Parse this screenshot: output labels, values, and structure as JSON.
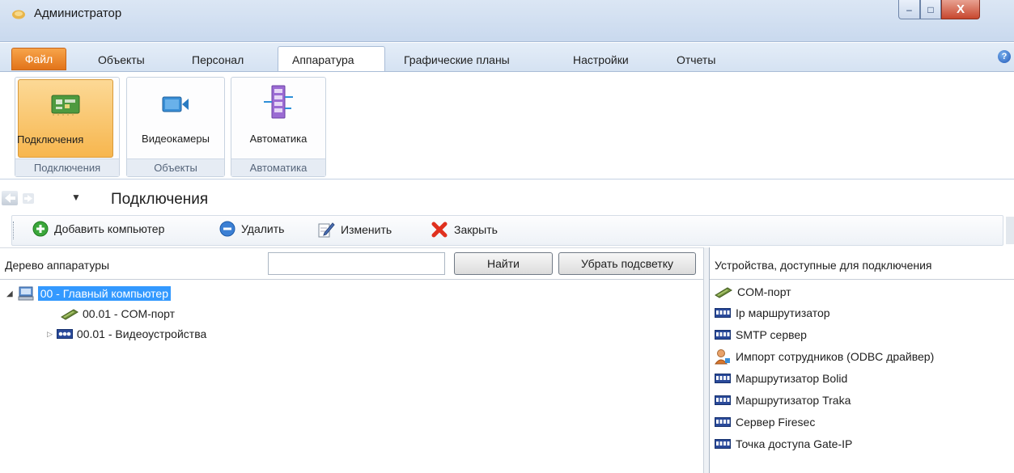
{
  "window": {
    "title": "Администратор",
    "buttons": {
      "minimize": "–",
      "maximize": "□",
      "close": "X"
    }
  },
  "tabs": {
    "file": "Файл",
    "items": [
      "Объекты",
      "Персонал",
      "Аппаратура",
      "Графические планы",
      "Настройки",
      "Отчеты"
    ],
    "active": "Аппаратура",
    "help": "?"
  },
  "ribbon": {
    "groups": [
      {
        "label": "Подключения",
        "button": "Подключения",
        "icon": "circuit-board-icon"
      },
      {
        "label": "Объекты",
        "button": "Видеокамеры",
        "icon": "video-camera-icon"
      },
      {
        "label": "Автоматика",
        "button": "Автоматика",
        "icon": "automation-icon"
      }
    ]
  },
  "nav": {
    "title": "Подключения"
  },
  "toolbar": {
    "add": "Добавить компьютер",
    "delete": "Удалить",
    "edit": "Изменить",
    "close": "Закрыть"
  },
  "tree_pane": {
    "label": "Дерево аппаратуры",
    "search_value": "",
    "find": "Найти",
    "clear_highlight": "Убрать подсветку",
    "nodes": [
      {
        "text": "00 - Главный компьютер",
        "icon": "computer-icon",
        "selected": true
      },
      {
        "text": "00.01 - COM-порт",
        "icon": "com-port-icon"
      },
      {
        "text": "00.01 - Видеоустройства",
        "icon": "video-devices-icon"
      }
    ]
  },
  "devices_pane": {
    "label": "Устройства, доступные для подключения",
    "items": [
      {
        "text": "COM-порт",
        "icon": "com-port-icon"
      },
      {
        "text": "Ip маршрутизатор",
        "icon": "router-icon"
      },
      {
        "text": "SMTP сервер",
        "icon": "router-icon"
      },
      {
        "text": "Импорт сотрудников (ODBC драйвер)",
        "icon": "person-import-icon"
      },
      {
        "text": "Маршрутизатор Bolid",
        "icon": "router-icon"
      },
      {
        "text": "Маршрутизатор Traka",
        "icon": "router-icon"
      },
      {
        "text": "Сервер Firesec",
        "icon": "router-icon"
      },
      {
        "text": "Точка доступа Gate-IP",
        "icon": "router-icon"
      }
    ]
  },
  "colors": {
    "file_tab": "#e2741a",
    "selection": "#3399ff",
    "ribbon_active": "#f7b64e"
  }
}
